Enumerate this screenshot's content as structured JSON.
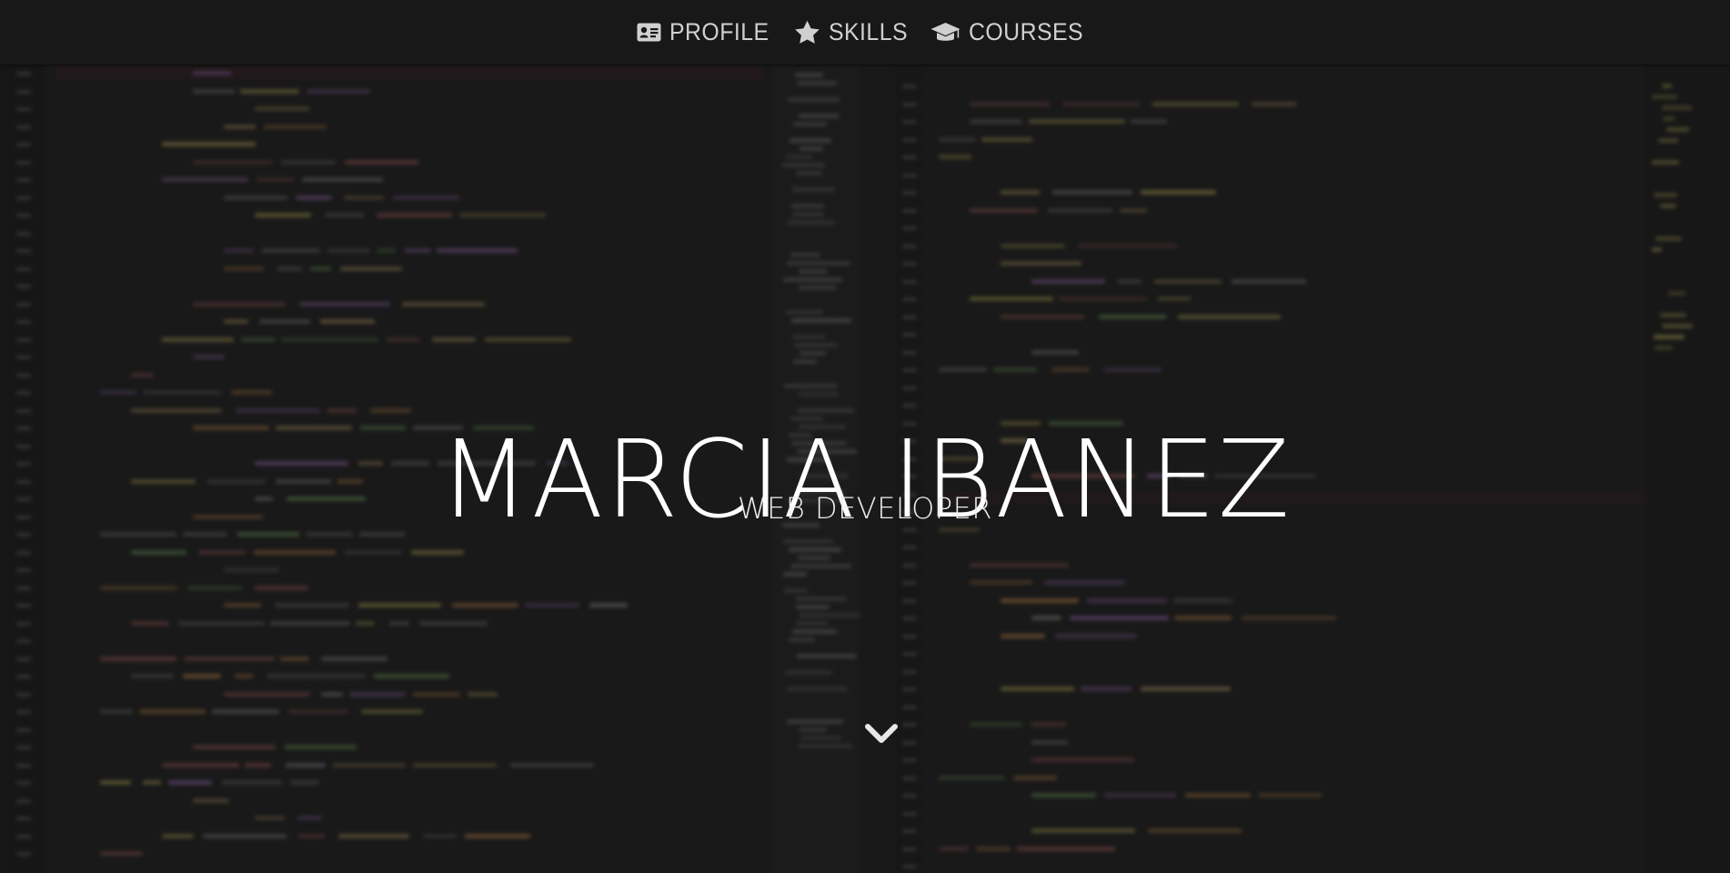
{
  "nav": {
    "items": [
      {
        "label": "PROFILE",
        "icon": "id-card-icon"
      },
      {
        "label": "SKILLS",
        "icon": "star-icon"
      },
      {
        "label": "COURSES",
        "icon": "graduation-cap-icon"
      }
    ]
  },
  "hero": {
    "name": "MARCIA IBANEZ",
    "subtitle": "WEB DEVELOPER",
    "scroll_icon": "chevron-down-icon"
  },
  "colors": {
    "navbar_bg": "#181818",
    "nav_text": "#d0d0d0",
    "hero_text": "#ffffff",
    "background": "#1e1e1e"
  }
}
